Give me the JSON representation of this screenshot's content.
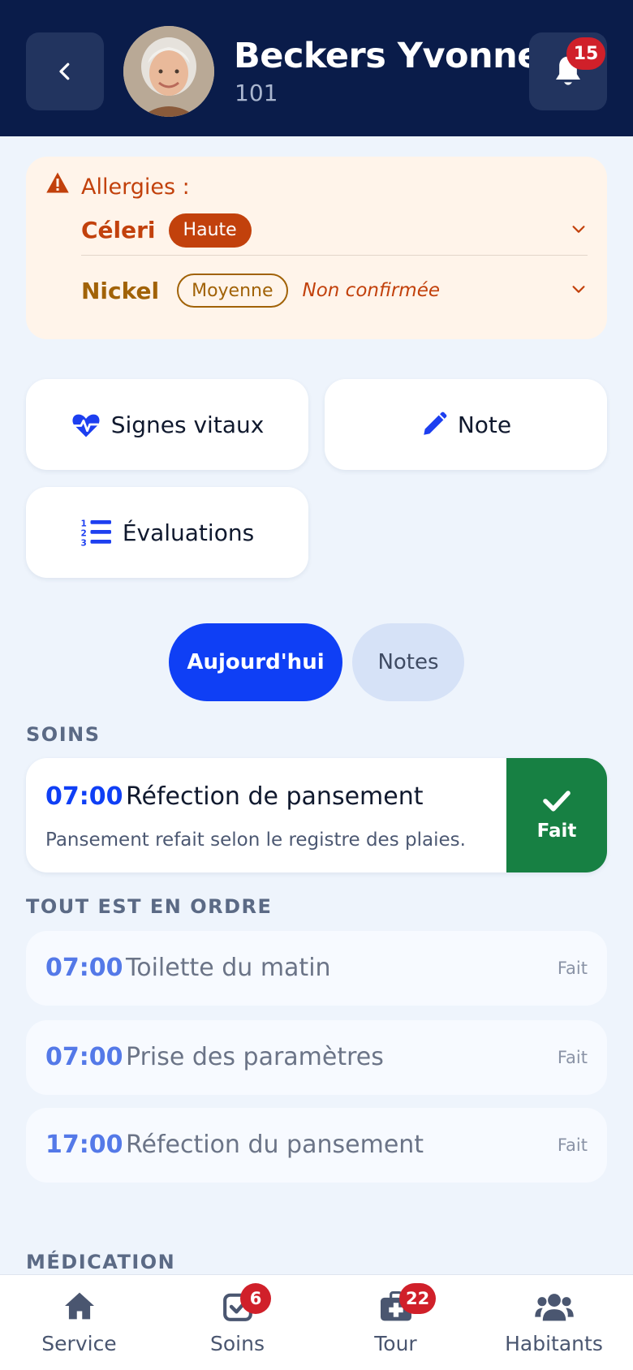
{
  "header": {
    "name": "Beckers Yvonne",
    "room": "101",
    "notification_count": "15"
  },
  "allergies": {
    "title": "Allergies :",
    "items": [
      {
        "name": "Céleri",
        "severity": "Haute",
        "status": ""
      },
      {
        "name": "Nickel",
        "severity": "Moyenne",
        "status": "Non confirmée"
      }
    ]
  },
  "actions": {
    "vitals": "Signes vitaux",
    "note": "Note",
    "evaluations": "Évaluations"
  },
  "tabs": {
    "today": "Aujourd'hui",
    "notes": "Notes"
  },
  "care": {
    "section_title": "SOINS",
    "featured": {
      "time": "07:00",
      "title": "Réfection de pansement",
      "description": "Pansement refait selon le registre des plaies.",
      "done_label": "Fait"
    }
  },
  "all_good": {
    "section_title": "TOUT EST EN ORDRE",
    "items": [
      {
        "time": "07:00",
        "title": "Toilette du matin",
        "status": "Fait"
      },
      {
        "time": "07:00",
        "title": "Prise des paramètres",
        "status": "Fait"
      },
      {
        "time": "17:00",
        "title": "Réfection du pansement",
        "status": "Fait"
      }
    ]
  },
  "medication": {
    "section_title": "MÉDICATION"
  },
  "bottom_nav": {
    "service": "Service",
    "care": "Soins",
    "care_badge": "6",
    "tour": "Tour",
    "tour_badge": "22",
    "residents": "Habitants"
  },
  "colors": {
    "header_bg": "#0a1c4a",
    "primary": "#0f3ff5",
    "done_green": "#178043",
    "allergy_high": "#c2410c",
    "allergy_mid": "#a16207",
    "badge_red": "#d0202a"
  }
}
